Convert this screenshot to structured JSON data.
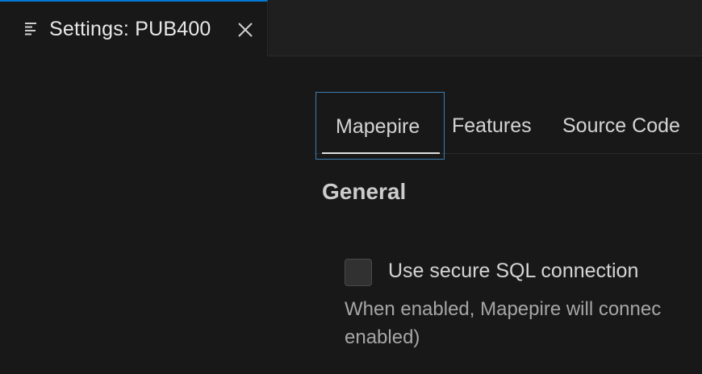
{
  "editor_tab": {
    "title": "Settings: PUB400",
    "icon": "settings-list-icon",
    "close_icon": "close-icon"
  },
  "settings_tabs": [
    {
      "label": "Mapepire",
      "active": true
    },
    {
      "label": "Features",
      "active": false
    },
    {
      "label": "Source Code",
      "active": false
    }
  ],
  "section": {
    "title": "General"
  },
  "setting": {
    "label": "Use secure SQL connection",
    "checked": false,
    "description_line1": "When enabled, Mapepire will connec",
    "description_line2": "enabled)"
  },
  "colors": {
    "accent": "#0078d4",
    "focus_border": "#3e7db0",
    "background": "#181818"
  }
}
